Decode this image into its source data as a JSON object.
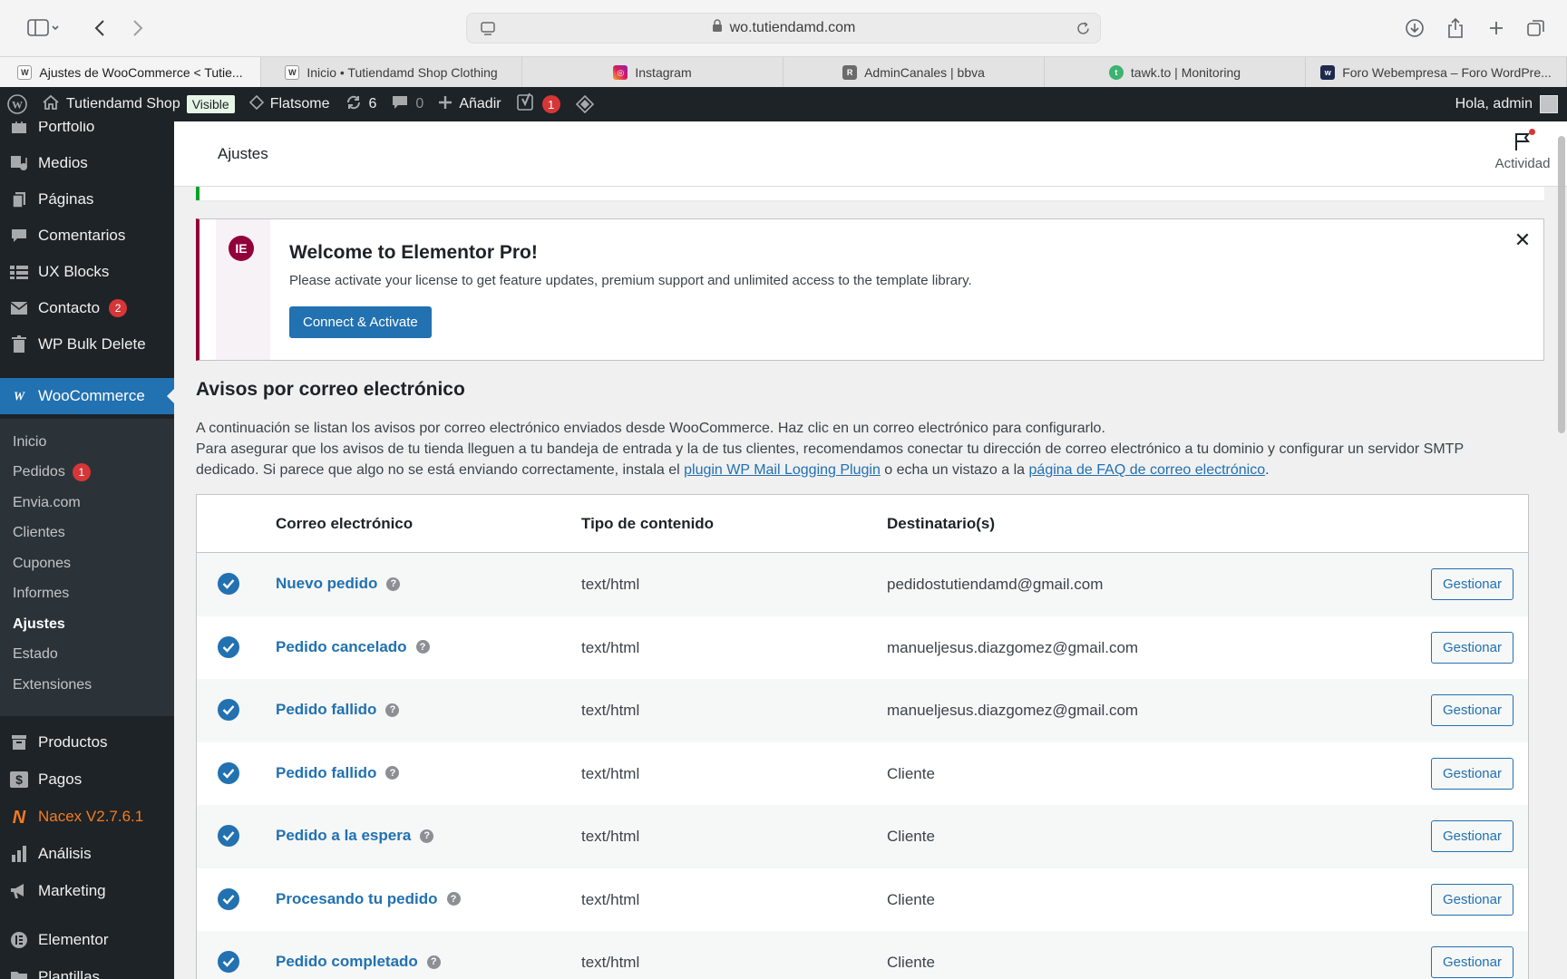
{
  "browser": {
    "url": "wo.tutiendamd.com",
    "tabs": [
      {
        "label": "Ajustes de WooCommerce < Tutie...",
        "favicon": "wp"
      },
      {
        "label": "Inicio • Tutiendamd Shop Clothing",
        "favicon": "wp"
      },
      {
        "label": "Instagram",
        "favicon": "instagram"
      },
      {
        "label": "AdminCanales | bbva",
        "favicon": "R"
      },
      {
        "label": "tawk.to | Monitoring",
        "favicon": "tawk"
      },
      {
        "label": "Foro Webempresa – Foro WordPre...",
        "favicon": "w"
      }
    ]
  },
  "adminbar": {
    "site_name": "Tutiendamd Shop",
    "visible": "Visible",
    "theme": "Flatsome",
    "updates": "6",
    "comments": "0",
    "add_new": "Añadir",
    "yoast_badge": "1",
    "greeting": "Hola, admin"
  },
  "sidebar": {
    "items_top": [
      {
        "label": "Portfolio",
        "icon": "portfolio-icon"
      },
      {
        "label": "Medios",
        "icon": "media-icon"
      },
      {
        "label": "Páginas",
        "icon": "pages-icon"
      },
      {
        "label": "Comentarios",
        "icon": "comments-icon"
      },
      {
        "label": "UX Blocks",
        "icon": "blocks-icon"
      },
      {
        "label": "Contacto",
        "icon": "mail-icon",
        "badge": "2"
      },
      {
        "label": "WP Bulk Delete",
        "icon": "trash-icon"
      }
    ],
    "woocommerce": "WooCommerce",
    "submenu": [
      {
        "label": "Inicio"
      },
      {
        "label": "Pedidos",
        "badge": "1"
      },
      {
        "label": "Envia.com"
      },
      {
        "label": "Clientes"
      },
      {
        "label": "Cupones"
      },
      {
        "label": "Informes"
      },
      {
        "label": "Ajustes",
        "current": true
      },
      {
        "label": "Estado"
      },
      {
        "label": "Extensiones"
      }
    ],
    "items_bottom": [
      {
        "label": "Productos",
        "icon": "archive-icon"
      },
      {
        "label": "Pagos",
        "icon": "dollar-icon"
      },
      {
        "label": "Nacex V2.7.6.1",
        "icon": "nacex-icon"
      },
      {
        "label": "Análisis",
        "icon": "chart-icon"
      },
      {
        "label": "Marketing",
        "icon": "megaphone-icon"
      },
      {
        "label": "Elementor",
        "icon": "elementor-icon"
      },
      {
        "label": "Plantillas",
        "icon": "folder-icon"
      }
    ]
  },
  "header": {
    "title": "Ajustes",
    "activity": "Actividad"
  },
  "elementor_notice": {
    "title": "Welcome to Elementor Pro!",
    "description": "Please activate your license to get feature updates, premium support and unlimited access to the template library.",
    "button": "Connect & Activate"
  },
  "emails_section": {
    "heading": "Avisos por correo electrónico",
    "line1": "A continuación se listan los avisos por correo electrónico enviados desde WooCommerce. Haz clic en un correo electrónico para configurarlo.",
    "line2_start": "Para asegurar que los avisos de tu tienda lleguen a tu bandeja de entrada y la de tus clientes, recomendamos conectar tu dirección de correo electrónico a tu dominio y configurar un servidor SMTP dedicado. Si parece que algo no se está enviando correctamente, instala el ",
    "link1": "plugin WP Mail Logging Plugin",
    "line2_mid": " o echa un vistazo a la ",
    "link2": "página de FAQ de correo electrónico",
    "line2_end": "."
  },
  "table": {
    "columns": [
      "Correo electrónico",
      "Tipo de contenido",
      "Destinatario(s)"
    ],
    "manage_label": "Gestionar",
    "rows": [
      {
        "name": "Nuevo pedido",
        "type": "text/html",
        "recipient": "pedidostutiendamd@gmail.com"
      },
      {
        "name": "Pedido cancelado",
        "type": "text/html",
        "recipient": "manueljesus.diazgomez@gmail.com"
      },
      {
        "name": "Pedido fallido",
        "type": "text/html",
        "recipient": "manueljesus.diazgomez@gmail.com"
      },
      {
        "name": "Pedido fallido",
        "type": "text/html",
        "recipient": "Cliente"
      },
      {
        "name": "Pedido a la espera",
        "type": "text/html",
        "recipient": "Cliente"
      },
      {
        "name": "Procesando tu pedido",
        "type": "text/html",
        "recipient": "Cliente"
      },
      {
        "name": "Pedido completado",
        "type": "text/html",
        "recipient": "Cliente"
      }
    ]
  },
  "colors": {
    "admin_dark": "#1d2327",
    "wp_blue": "#2271b1",
    "elementor": "#92003b",
    "badge_red": "#d63638"
  }
}
